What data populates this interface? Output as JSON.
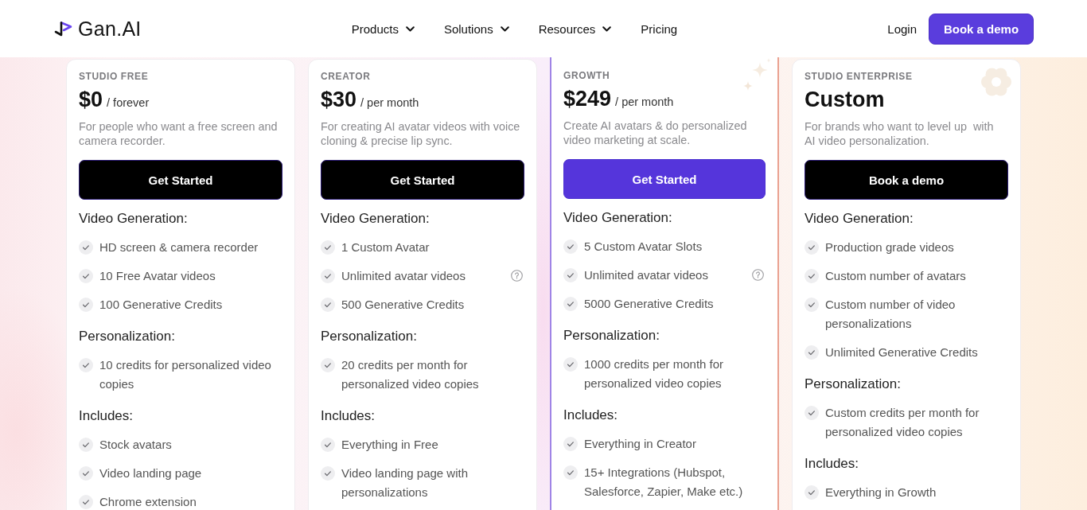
{
  "header": {
    "logo": "Gan.AI",
    "nav": [
      {
        "label": "Products",
        "dropdown": true
      },
      {
        "label": "Solutions",
        "dropdown": true
      },
      {
        "label": "Resources",
        "dropdown": true
      },
      {
        "label": "Pricing",
        "dropdown": false
      }
    ],
    "login": "Login",
    "cta": "Book a demo"
  },
  "plans": [
    {
      "kind": "basic",
      "name": "STUDIO FREE",
      "price": "$0",
      "period": "/ forever",
      "description": "For people who want a free screen and camera recorder.",
      "button": "Get Started",
      "sections": [
        {
          "title": "Video Generation:",
          "features": [
            {
              "text": "HD screen & camera recorder",
              "info": false
            },
            {
              "text": "10 Free Avatar videos",
              "info": false
            },
            {
              "text": "100 Generative Credits",
              "info": false
            }
          ]
        },
        {
          "title": "Personalization:",
          "features": [
            {
              "text": "10 credits for personalized video copies",
              "info": false
            }
          ]
        },
        {
          "title": "Includes:",
          "features": [
            {
              "text": "Stock avatars",
              "info": false
            },
            {
              "text": "Video landing page",
              "info": false
            },
            {
              "text": "Chrome extension",
              "info": false
            }
          ]
        }
      ]
    },
    {
      "kind": "basic",
      "name": "CREATOR",
      "price": "$30",
      "period": "/ per month",
      "description": "For creating AI avatar videos with voice cloning & precise lip sync.",
      "button": "Get Started",
      "sections": [
        {
          "title": "Video Generation:",
          "features": [
            {
              "text": "1 Custom Avatar",
              "info": false
            },
            {
              "text": "Unlimited avatar videos",
              "info": true
            },
            {
              "text": "500 Generative Credits",
              "info": false
            }
          ]
        },
        {
          "title": "Personalization:",
          "features": [
            {
              "text": "20 credits per month for personalized video copies",
              "info": false
            }
          ]
        },
        {
          "title": "Includes:",
          "features": [
            {
              "text": "Everything in Free",
              "info": false
            },
            {
              "text": "Video landing page with personalizations",
              "info": false
            }
          ]
        }
      ]
    },
    {
      "kind": "featured",
      "name": "GROWTH",
      "price": "$249",
      "period": "/ per month",
      "description": "Create AI avatars & do personalized video marketing at scale.",
      "button": "Get Started",
      "sections": [
        {
          "title": "Video Generation:",
          "features": [
            {
              "text": "5 Custom Avatar Slots",
              "info": false
            },
            {
              "text": "Unlimited avatar videos",
              "info": true
            },
            {
              "text": "5000 Generative Credits",
              "info": false
            }
          ]
        },
        {
          "title": "Personalization:",
          "features": [
            {
              "text": "1000 credits per month for personalized video copies",
              "info": false
            }
          ]
        },
        {
          "title": "Includes:",
          "features": [
            {
              "text": "Everything in Creator",
              "info": false
            },
            {
              "text": "15+ Integrations (Hubspot, Salesforce, Zapier, Make etc.)",
              "info": false
            }
          ]
        }
      ]
    },
    {
      "kind": "enterprise",
      "name": "STUDIO ENTERPRISE",
      "price": "Custom",
      "description": "For brands who want to level up  with AI video personalization.",
      "button": "Book a demo",
      "sections": [
        {
          "title": "Video Generation:",
          "features": [
            {
              "text": "Production grade videos",
              "info": false
            },
            {
              "text": "Custom number of avatars",
              "info": false
            },
            {
              "text": "Custom number of video personalizations",
              "info": false
            },
            {
              "text": "Unlimited Generative Credits",
              "info": false
            }
          ]
        },
        {
          "title": "Personalization:",
          "features": [
            {
              "text": "Custom credits per month for personalized video copies",
              "info": false
            }
          ]
        },
        {
          "title": "Includes:",
          "features": [
            {
              "text": "Everything in Growth",
              "info": false
            }
          ]
        }
      ]
    }
  ]
}
